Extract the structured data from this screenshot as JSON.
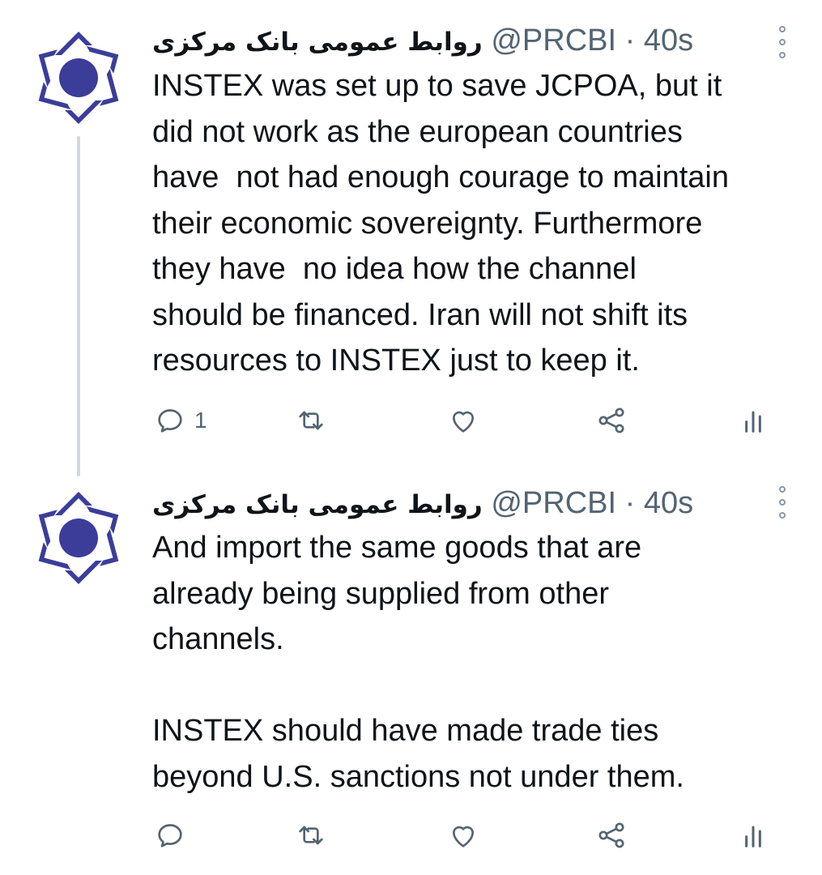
{
  "colors": {
    "brand_logo": "#3b3d99",
    "icon_gray": "#536471",
    "thread_line": "#cfd9de"
  },
  "tweets": [
    {
      "display_name": "روابط عمومی بانک مرکزی",
      "handle": "@PRCBI",
      "separator": "·",
      "time": "40s",
      "text": "INSTEX was set up to save JCPOA, but it\ndid not work as the european countries\nhave  not had enough courage to maintain\ntheir economic sovereignty. Furthermore\nthey have  no idea how the channel\nshould be financed. Iran will not shift its\nresources to INSTEX just to keep it.",
      "reply_count": "1",
      "icons": [
        "reply-icon",
        "retweet-icon",
        "like-icon",
        "share-icon",
        "analytics-icon"
      ]
    },
    {
      "display_name": "روابط عمومی بانک مرکزی",
      "handle": "@PRCBI",
      "separator": "·",
      "time": "40s",
      "text": "And import the same goods that are\nalready being supplied from other\nchannels.\n\nINSTEX should have made trade ties\nbeyond U.S. sanctions not under them.",
      "reply_count": "",
      "icons": [
        "reply-icon",
        "retweet-icon",
        "like-icon",
        "share-icon",
        "analytics-icon"
      ]
    }
  ]
}
